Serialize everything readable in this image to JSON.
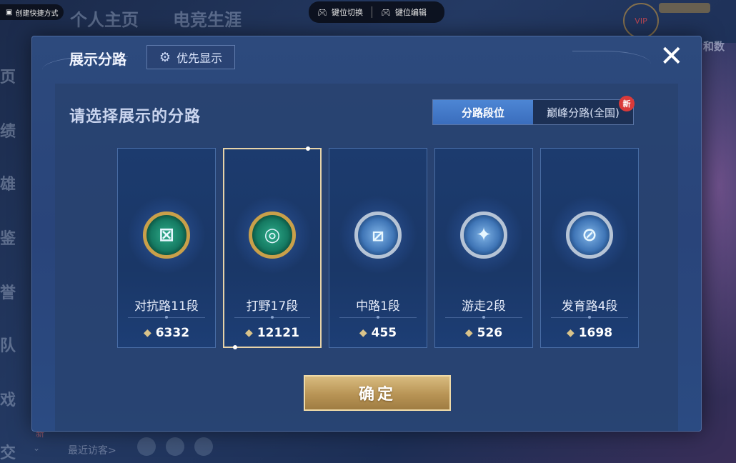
{
  "background": {
    "top_tabs": [
      "个人主页",
      "电竞生涯"
    ],
    "left_nav": [
      "页",
      "绩",
      "雄",
      "鉴",
      "誉",
      "队",
      "戏",
      "交"
    ],
    "new_tag": "新",
    "shortcut_label": "创建快捷方式",
    "key_switch": "键位切换",
    "key_edit": "键位编辑",
    "vip_label": "VIP",
    "right_text": "和数",
    "recent_visitors": "最近访客>"
  },
  "modal": {
    "title": "展示分路",
    "priority_button": "优先显示",
    "close_label": "✕",
    "subtitle": "请选择展示的分路",
    "tabs": [
      {
        "label": "分路段位",
        "active": true
      },
      {
        "label": "巅峰分路(全国)",
        "active": false,
        "badge": "新"
      }
    ],
    "cards": [
      {
        "label": "对抗路11段",
        "score": "6332",
        "emblem": "gold",
        "symbol": "⊠",
        "selected": false
      },
      {
        "label": "打野17段",
        "score": "12121",
        "emblem": "gold",
        "symbol": "◎",
        "selected": true
      },
      {
        "label": "中路1段",
        "score": "455",
        "emblem": "silver",
        "symbol": "⧄",
        "selected": false
      },
      {
        "label": "游走2段",
        "score": "526",
        "emblem": "silver",
        "symbol": "✦",
        "selected": false
      },
      {
        "label": "发育路4段",
        "score": "1698",
        "emblem": "silver",
        "symbol": "⊘",
        "selected": false
      }
    ],
    "confirm_label": "确定"
  },
  "colors": {
    "accent_gold": "#c9a04a",
    "tab_active": "#4d86d4",
    "new_badge": "#d93a3a"
  }
}
